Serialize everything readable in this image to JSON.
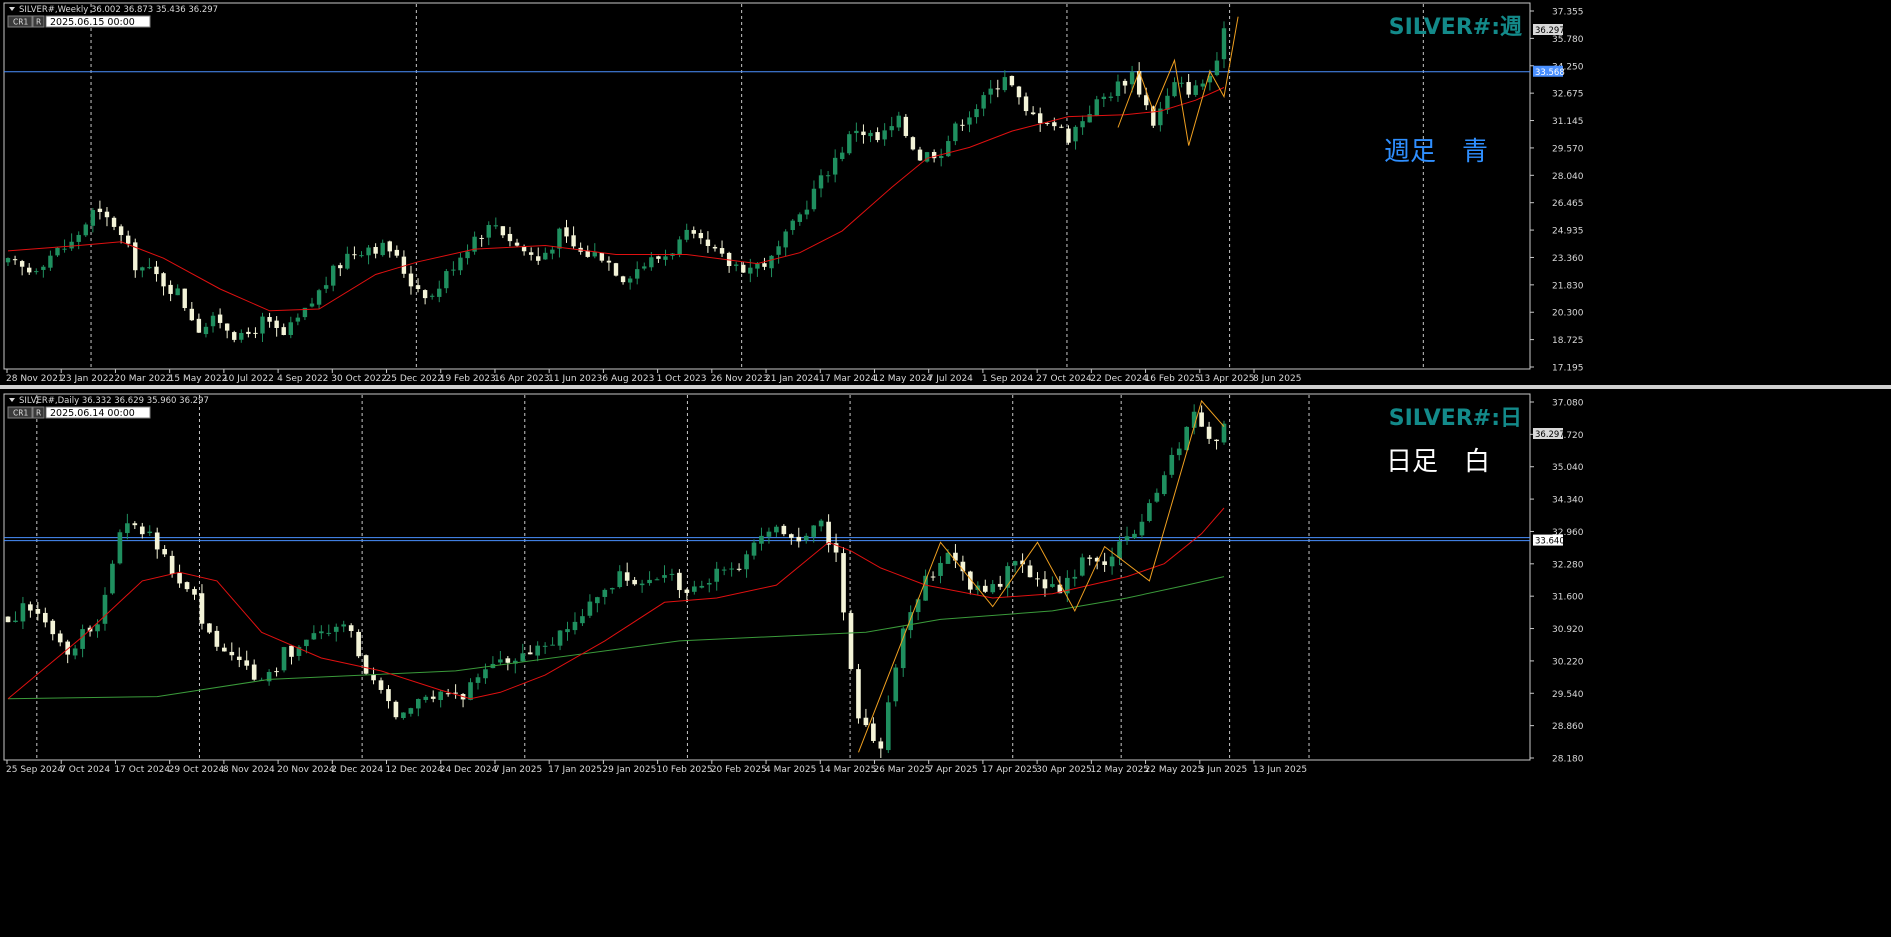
{
  "colors": {
    "background": "#000000",
    "frame": "#c8c8c8",
    "grid": "#c8c8c8",
    "bull_candle": "#1f8f5f",
    "bear_candle": "#f4f4d8",
    "ma_red": "#e01010",
    "ma_green": "#3a9a3a",
    "zigzag": "#f0a020",
    "hline": "#4a90ff",
    "title_teal": "#138a8a",
    "label_blue": "#2f8fff",
    "label_white": "#ffffff",
    "price_box_bg": "#d8d8d8",
    "price_box_text": "#000000"
  },
  "chart_data": [
    {
      "type": "candlestick",
      "header": "SILVER#,Weekly  36.002 36.873 35.436 36.297",
      "cr_button": "CR1",
      "r_button": "R",
      "datetime_box": "2025.06.15 00:00",
      "title": "SILVER#:週",
      "annotation": "週足　青",
      "ylim": [
        17.195,
        37.355
      ],
      "yticks": [
        "37.355",
        "35.780",
        "34.250",
        "32.675",
        "31.145",
        "29.570",
        "28.040",
        "26.465",
        "24.935",
        "23.360",
        "21.830",
        "20.300",
        "18.725",
        "17.195"
      ],
      "current_price": "36.297",
      "hline_value": 33.568,
      "hline_label": "33.568",
      "xticks": [
        "28 Nov 2021",
        "23 Jan 2022",
        "20 Mar 2022",
        "15 May 2022",
        "10 Jul 2022",
        "4 Sep 2022",
        "30 Oct 2022",
        "25 Dec 2022",
        "19 Feb 2023",
        "16 Apr 2023",
        "11 Jun 2023",
        "6 Aug 2023",
        "1 Oct 2023",
        "26 Nov 2023",
        "21 Jan 2024",
        "17 Mar 2024",
        "12 May 2024",
        "7 Jul 2024",
        "1 Sep 2024",
        "27 Oct 2024",
        "22 Dec 2024",
        "16 Feb 2025",
        "13 Apr 2025",
        "8 Jun 2025"
      ],
      "grid_after_tick": [
        1,
        7,
        13,
        19,
        22
      ],
      "grid_extra_fraction": 0.93,
      "close_path": [
        [
          0,
          23.0
        ],
        [
          3,
          22.6
        ],
        [
          6,
          23.5
        ],
        [
          9,
          24.1
        ],
        [
          12,
          25.8
        ],
        [
          15,
          25.2
        ],
        [
          18,
          23.0
        ],
        [
          21,
          22.3
        ],
        [
          24,
          21.4
        ],
        [
          27,
          19.5
        ],
        [
          30,
          19.9
        ],
        [
          33,
          18.8
        ],
        [
          36,
          19.8
        ],
        [
          39,
          19.0
        ],
        [
          42,
          20.3
        ],
        [
          45,
          22.0
        ],
        [
          48,
          23.5
        ],
        [
          51,
          24.0
        ],
        [
          54,
          23.8
        ],
        [
          57,
          22.0
        ],
        [
          60,
          21.2
        ],
        [
          63,
          23.0
        ],
        [
          66,
          24.5
        ],
        [
          69,
          25.2
        ],
        [
          72,
          24.0
        ],
        [
          75,
          23.2
        ],
        [
          78,
          24.6
        ],
        [
          81,
          23.6
        ],
        [
          84,
          23.5
        ],
        [
          87,
          22.3
        ],
        [
          90,
          23.0
        ],
        [
          93,
          23.5
        ],
        [
          96,
          24.5
        ],
        [
          99,
          23.8
        ],
        [
          102,
          23.0
        ],
        [
          105,
          22.8
        ],
        [
          108,
          23.2
        ],
        [
          111,
          25.0
        ],
        [
          114,
          27.0
        ],
        [
          117,
          28.8
        ],
        [
          120,
          30.5
        ],
        [
          123,
          29.8
        ],
        [
          126,
          30.8
        ],
        [
          129,
          28.9
        ],
        [
          132,
          29.3
        ],
        [
          135,
          31.0
        ],
        [
          138,
          32.0
        ],
        [
          141,
          33.5
        ],
        [
          144,
          31.2
        ],
        [
          147,
          31.0
        ],
        [
          150,
          30.0
        ],
        [
          153,
          31.5
        ],
        [
          156,
          32.5
        ],
        [
          159,
          33.5
        ],
        [
          162,
          30.8
        ],
        [
          165,
          32.8
        ],
        [
          168,
          32.6
        ],
        [
          171,
          33.8
        ],
        [
          172,
          36.3
        ]
      ],
      "ma_path": [
        [
          0,
          23.7
        ],
        [
          10,
          24.0
        ],
        [
          16,
          24.2
        ],
        [
          22,
          23.3
        ],
        [
          30,
          21.6
        ],
        [
          37,
          20.4
        ],
        [
          44,
          20.5
        ],
        [
          52,
          22.4
        ],
        [
          58,
          23.1
        ],
        [
          66,
          23.8
        ],
        [
          76,
          24.0
        ],
        [
          86,
          23.5
        ],
        [
          96,
          23.5
        ],
        [
          106,
          23.0
        ],
        [
          112,
          23.6
        ],
        [
          118,
          24.8
        ],
        [
          125,
          27.2
        ],
        [
          130,
          28.8
        ],
        [
          136,
          29.4
        ],
        [
          142,
          30.3
        ],
        [
          150,
          31.1
        ],
        [
          158,
          31.2
        ],
        [
          163,
          31.4
        ],
        [
          168,
          32.0
        ],
        [
          172,
          32.7
        ]
      ],
      "zigzag": [
        [
          157,
          30.5
        ],
        [
          160,
          33.6
        ],
        [
          162,
          31.4
        ],
        [
          165,
          34.2
        ],
        [
          167,
          29.5
        ],
        [
          170,
          33.6
        ],
        [
          172,
          32.2
        ],
        [
          174,
          36.6
        ]
      ]
    },
    {
      "type": "candlestick",
      "header": "SILVER#,Daily  36.332 36.629 35.960 36.297",
      "cr_button": "CR1",
      "r_button": "R",
      "datetime_box": "2025.06.14 00:00",
      "title": "SILVER#:日",
      "annotation": "日足　白",
      "ylim": [
        28.52,
        37.06
      ],
      "yticks": [
        "37.080",
        "35.720",
        "35.040",
        "34.340",
        "32.960",
        "32.280",
        "31.600",
        "30.920",
        "30.220",
        "29.540",
        "28.860",
        "28.180"
      ],
      "current_price": "36.297",
      "hline_value": 33.64,
      "hline_label": "33.640",
      "xticks": [
        "25 Sep 2024",
        "7 Oct 2024",
        "17 Oct 2024",
        "29 Oct 2024",
        "8 Nov 2024",
        "20 Nov 2024",
        "2 Dec 2024",
        "12 Dec 2024",
        "24 Dec 2024",
        "7 Jan 2025",
        "17 Jan 2025",
        "29 Jan 2025",
        "10 Feb 2025",
        "20 Feb 2025",
        "4 Mar 2025",
        "14 Mar 2025",
        "26 Mar 2025",
        "7 Apr 2025",
        "17 Apr 2025",
        "30 Apr 2025",
        "12 May 2025",
        "22 May 2025",
        "3 Jun 2025",
        "13 Jun 2025"
      ],
      "grid_after_tick": [
        0,
        3,
        6,
        9,
        12,
        15,
        18,
        20,
        22
      ],
      "grid_extra_fraction": 0.855,
      "close_path": [
        [
          0,
          31.9
        ],
        [
          4,
          32.1
        ],
        [
          8,
          31.0
        ],
        [
          12,
          31.8
        ],
        [
          15,
          33.8
        ],
        [
          17,
          34.0
        ],
        [
          19,
          33.8
        ],
        [
          22,
          33.0
        ],
        [
          25,
          32.2
        ],
        [
          28,
          31.0
        ],
        [
          31,
          30.8
        ],
        [
          34,
          30.3
        ],
        [
          37,
          31.0
        ],
        [
          40,
          31.2
        ],
        [
          43,
          31.6
        ],
        [
          46,
          31.5
        ],
        [
          49,
          30.3
        ],
        [
          52,
          29.6
        ],
        [
          55,
          29.8
        ],
        [
          58,
          30.2
        ],
        [
          61,
          30.1
        ],
        [
          64,
          30.5
        ],
        [
          67,
          30.8
        ],
        [
          70,
          31.0
        ],
        [
          73,
          31.2
        ],
        [
          76,
          31.8
        ],
        [
          79,
          32.3
        ],
        [
          82,
          32.8
        ],
        [
          85,
          32.5
        ],
        [
          88,
          32.9
        ],
        [
          91,
          32.3
        ],
        [
          94,
          32.8
        ],
        [
          97,
          32.9
        ],
        [
          100,
          33.6
        ],
        [
          103,
          33.8
        ],
        [
          106,
          33.5
        ],
        [
          109,
          34.0
        ],
        [
          111,
          33.2
        ],
        [
          114,
          29.5
        ],
        [
          117,
          28.9
        ],
        [
          120,
          31.5
        ],
        [
          123,
          32.7
        ],
        [
          126,
          33.5
        ],
        [
          129,
          32.6
        ],
        [
          132,
          32.5
        ],
        [
          135,
          33.1
        ],
        [
          138,
          32.8
        ],
        [
          141,
          32.4
        ],
        [
          144,
          33.1
        ],
        [
          147,
          33.2
        ],
        [
          150,
          33.6
        ],
        [
          153,
          34.4
        ],
        [
          156,
          35.6
        ],
        [
          159,
          36.5
        ],
        [
          162,
          36.0
        ],
        [
          163,
          36.3
        ]
      ],
      "ma_red_path": [
        [
          0,
          29.95
        ],
        [
          10,
          31.4
        ],
        [
          18,
          32.7
        ],
        [
          23,
          32.9
        ],
        [
          28,
          32.7
        ],
        [
          34,
          31.5
        ],
        [
          42,
          30.9
        ],
        [
          50,
          30.6
        ],
        [
          58,
          30.15
        ],
        [
          62,
          29.95
        ],
        [
          66,
          30.1
        ],
        [
          72,
          30.5
        ],
        [
          80,
          31.3
        ],
        [
          88,
          32.2
        ],
        [
          95,
          32.3
        ],
        [
          103,
          32.6
        ],
        [
          110,
          33.6
        ],
        [
          113,
          33.4
        ],
        [
          117,
          33.0
        ],
        [
          123,
          32.6
        ],
        [
          132,
          32.3
        ],
        [
          140,
          32.4
        ],
        [
          150,
          32.8
        ],
        [
          155,
          33.1
        ],
        [
          160,
          33.8
        ],
        [
          163,
          34.4
        ]
      ],
      "ma_green_path": [
        [
          0,
          29.95
        ],
        [
          20,
          30.0
        ],
        [
          35,
          30.4
        ],
        [
          60,
          30.6
        ],
        [
          90,
          31.3
        ],
        [
          115,
          31.5
        ],
        [
          125,
          31.8
        ],
        [
          140,
          32.0
        ],
        [
          150,
          32.3
        ],
        [
          158,
          32.6
        ],
        [
          163,
          32.8
        ]
      ],
      "zigzag": [
        [
          114,
          28.7
        ],
        [
          125,
          33.6
        ],
        [
          132,
          32.1
        ],
        [
          138,
          33.6
        ],
        [
          143,
          32.0
        ],
        [
          147,
          33.5
        ],
        [
          153,
          32.7
        ],
        [
          160,
          36.9
        ],
        [
          163,
          36.3
        ]
      ]
    }
  ]
}
